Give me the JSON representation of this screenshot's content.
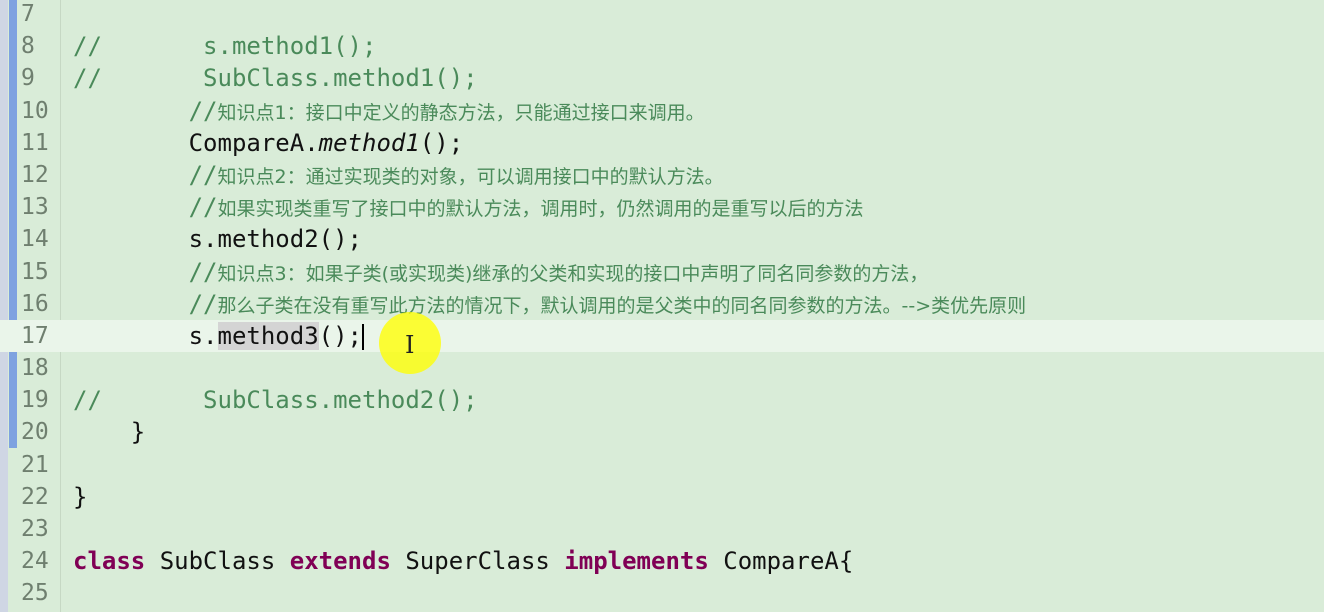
{
  "editor": {
    "lines": [
      {
        "num": "7"
      },
      {
        "num": "8",
        "parts": [
          {
            "t": "//",
            "c": "cm"
          },
          {
            "t": "       s.method1();",
            "c": "cm"
          }
        ]
      },
      {
        "num": "9",
        "parts": [
          {
            "t": "//",
            "c": "cm"
          },
          {
            "t": "       SubClass.method1();",
            "c": "cm"
          }
        ]
      },
      {
        "num": "10",
        "parts": [
          {
            "t": "        //",
            "c": "cm"
          },
          {
            "t": "知识点1：接口中定义的静态方法，只能通过接口来调用。",
            "c": "cm-cn"
          }
        ]
      },
      {
        "num": "11",
        "parts": [
          {
            "t": "        CompareA."
          },
          {
            "t": "method1",
            "c": "it"
          },
          {
            "t": "();"
          }
        ]
      },
      {
        "num": "12",
        "parts": [
          {
            "t": "        //",
            "c": "cm"
          },
          {
            "t": "知识点2：通过实现类的对象，可以调用接口中的默认方法。",
            "c": "cm-cn"
          }
        ]
      },
      {
        "num": "13",
        "parts": [
          {
            "t": "        //",
            "c": "cm"
          },
          {
            "t": "如果实现类重写了接口中的默认方法，调用时，仍然调用的是重写以后的方法",
            "c": "cm-cn"
          }
        ]
      },
      {
        "num": "14",
        "parts": [
          {
            "t": "        s.method2();"
          }
        ]
      },
      {
        "num": "15",
        "parts": [
          {
            "t": "        //",
            "c": "cm"
          },
          {
            "t": "知识点3：如果子类(或实现类)继承的父类和实现的接口中声明了同名同参数的方法，",
            "c": "cm-cn"
          }
        ]
      },
      {
        "num": "16",
        "parts": [
          {
            "t": "        //",
            "c": "cm"
          },
          {
            "t": "那么子类在没有重写此方法的情况下，默认调用的是父类中的同名同参数的方法。-->类优先原则",
            "c": "cm-cn"
          }
        ]
      },
      {
        "num": "17",
        "current": true,
        "parts": [
          {
            "t": "        s."
          },
          {
            "t": "method3",
            "c": "hl"
          },
          {
            "t": "();"
          }
        ]
      },
      {
        "num": "18"
      },
      {
        "num": "19",
        "parts": [
          {
            "t": "//",
            "c": "cm"
          },
          {
            "t": "       SubClass.method2();",
            "c": "cm"
          }
        ]
      },
      {
        "num": "20",
        "parts": [
          {
            "t": "    }"
          }
        ]
      },
      {
        "num": "21"
      },
      {
        "num": "22",
        "parts": [
          {
            "t": "}"
          }
        ]
      },
      {
        "num": "23"
      },
      {
        "num": "24",
        "parts": [
          {
            "t": "class",
            "c": "kw"
          },
          {
            "t": " SubClass "
          },
          {
            "t": "extends",
            "c": "kw"
          },
          {
            "t": " SuperClass "
          },
          {
            "t": "implements",
            "c": "kw"
          },
          {
            "t": " CompareA{"
          }
        ]
      },
      {
        "num": "25"
      }
    ]
  },
  "colors": {
    "background": "#d9ecd8",
    "comment": "#4a8a5a",
    "keyword": "#800055",
    "current_line": "#eaf5ea",
    "change_bar": "#7ea2e0",
    "cursor_highlight": "#ffff00"
  },
  "icons": {
    "mouse_cursor": "i-beam-cursor-icon"
  }
}
